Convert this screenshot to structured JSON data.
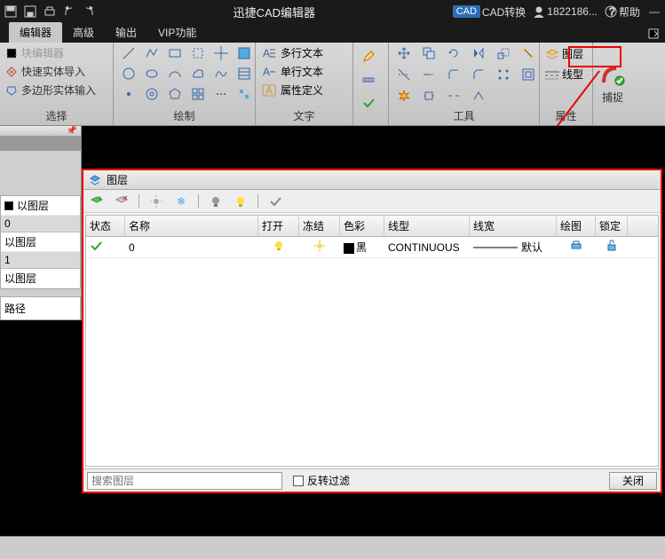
{
  "titlebar": {
    "title": "迅捷CAD编辑器",
    "cad_convert": "CAD转换",
    "user": "1822186...",
    "help": "帮助"
  },
  "tabs": {
    "editor": "编辑器",
    "advanced": "高级",
    "output": "输出",
    "vip": "VIP功能"
  },
  "ribbon": {
    "block_editor": "块编辑器",
    "quick_import": "快速实体导入",
    "poly_import": "多边形实体输入",
    "select_label": "选择",
    "draw_label": "绘制",
    "text_multi": "多行文本",
    "text_single": "单行文本",
    "attr_def": "属性定义",
    "text_label": "文字",
    "tools_label": "工具",
    "attr_label": "属性",
    "layer": "图层",
    "linetype": "线型",
    "snap": "捕捉"
  },
  "dock": {
    "by_layer": "以图层",
    "zero": "0",
    "one": "1",
    "path": "路径"
  },
  "dialog": {
    "title": "图层",
    "cols": {
      "status": "状态",
      "name": "名称",
      "open": "打开",
      "freeze": "冻结",
      "color": "色彩",
      "ltype": "线型",
      "lw": "线宽",
      "plot": "绘图",
      "lock": "锁定"
    },
    "row0": {
      "name": "0",
      "color": "黑",
      "ltype": "CONTINUOUS",
      "lw": "默认"
    },
    "search_ph": "搜索图层",
    "invert": "反转过滤",
    "close": "关闭"
  }
}
